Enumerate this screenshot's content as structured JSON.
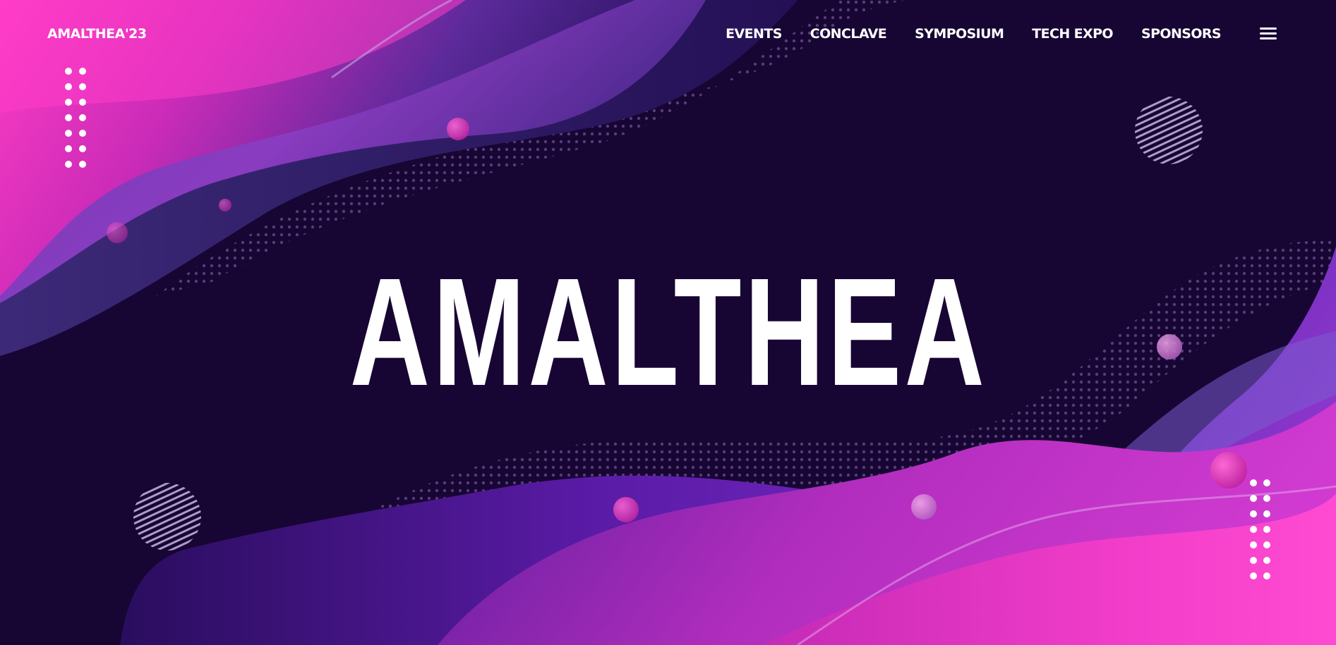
{
  "brand": {
    "label": "AMALTHEA'23"
  },
  "nav": {
    "items": [
      {
        "label": "EVENTS"
      },
      {
        "label": "CONCLAVE"
      },
      {
        "label": "SYMPOSIUM"
      },
      {
        "label": "TECH EXPO"
      },
      {
        "label": "SPONSORS"
      }
    ],
    "menu_icon": "hamburger-menu-icon"
  },
  "hero": {
    "title": "AMALTHEA"
  },
  "colors": {
    "background": "#170533",
    "magenta": "#e62bb9",
    "purple": "#6a2bb0",
    "indigo": "#3a2a78",
    "text": "#ffffff"
  }
}
